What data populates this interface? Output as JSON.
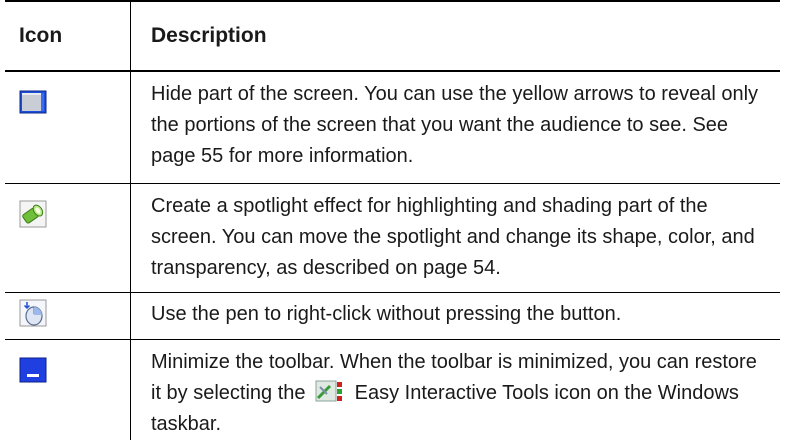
{
  "table": {
    "headers": {
      "icon": "Icon",
      "description": "Description"
    },
    "rows": [
      {
        "icon": "hide-screen-icon",
        "description": "Hide part of the screen. You can use the yellow arrows to reveal only the portions of the screen that you want the audience to see. See page 55 for more information."
      },
      {
        "icon": "spotlight-icon",
        "description": "Create a spotlight effect for highlighting and shading part of the screen. You can move the spotlight and change its shape, color, and transparency, as described on page 54."
      },
      {
        "icon": "right-click-mouse-icon",
        "description": "Use the pen to right-click without pressing the button."
      },
      {
        "icon": "minimize-toolbar-icon",
        "description_before": "Minimize the toolbar. When the toolbar is minimized, you can restore it by selecting the",
        "inline_icon": "easy-interactive-tools-icon",
        "description_after": "Easy Interactive Tools icon on the Windows taskbar."
      }
    ]
  }
}
